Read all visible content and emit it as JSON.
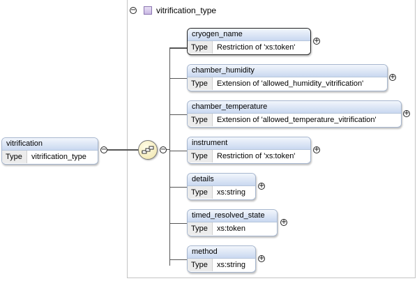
{
  "root": {
    "name": "vitrification",
    "type_label": "Type",
    "type_value": "vitrification_type"
  },
  "group": {
    "title": "vitrification_type"
  },
  "children": [
    {
      "name": "cryogen_name",
      "type_label": "Type",
      "type_value": "Restriction of 'xs:token'"
    },
    {
      "name": "chamber_humidity",
      "type_label": "Type",
      "type_value": "Extension of 'allowed_humidity_vitrification'"
    },
    {
      "name": "chamber_temperature",
      "type_label": "Type",
      "type_value": "Extension of 'allowed_temperature_vitrification'"
    },
    {
      "name": "instrument",
      "type_label": "Type",
      "type_value": "Restriction of 'xs:token'"
    },
    {
      "name": "details",
      "type_label": "Type",
      "type_value": "xs:string"
    },
    {
      "name": "timed_resolved_state",
      "type_label": "Type",
      "type_value": "xs:token"
    },
    {
      "name": "method",
      "type_label": "Type",
      "type_value": "xs:string"
    }
  ],
  "icons": {
    "collapse": "minus",
    "expand": "plus",
    "compositor": "sequence-icon",
    "group": "complex-type-icon"
  }
}
